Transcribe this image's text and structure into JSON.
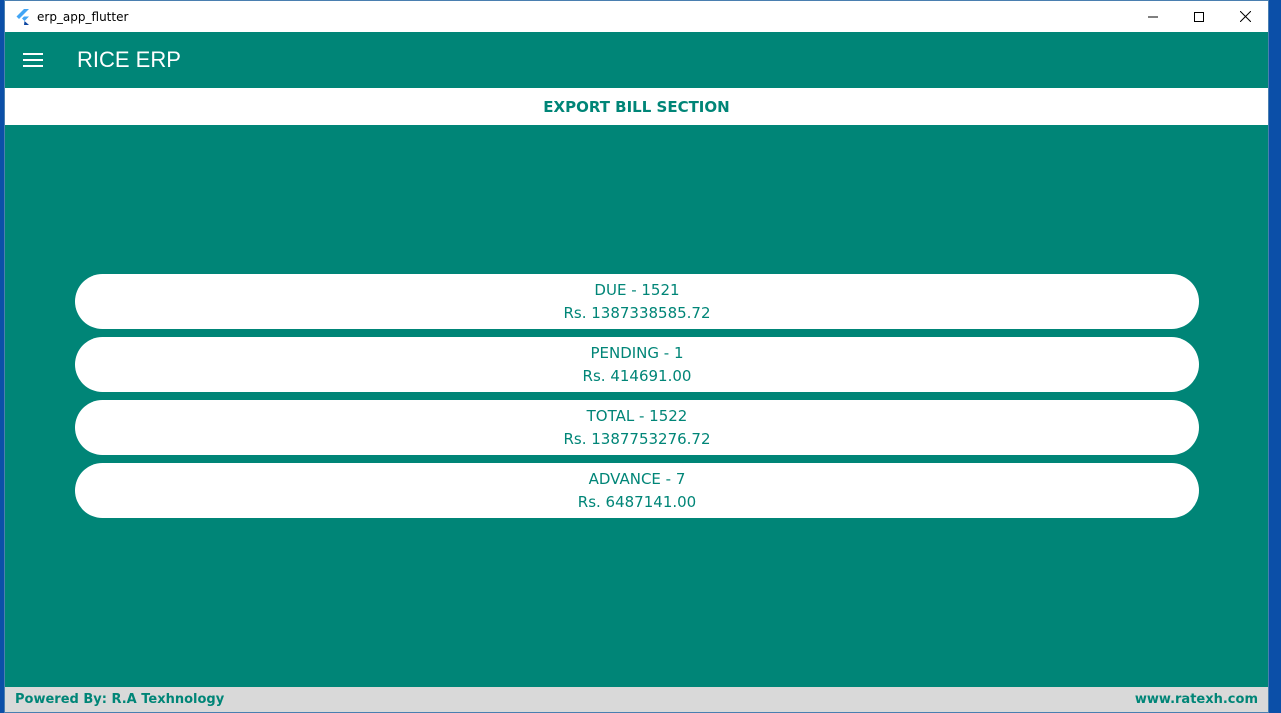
{
  "window": {
    "title": "erp_app_flutter",
    "controls": {
      "minimize_icon": "minimize-icon",
      "maximize_icon": "maximize-icon",
      "close_icon": "close-icon"
    }
  },
  "appbar": {
    "title": "RICE ERP",
    "menu_icon": "menu-icon"
  },
  "section": {
    "title": "EXPORT BILL SECTION"
  },
  "cards": [
    {
      "label": "DUE - 1521",
      "amount": "Rs. 1387338585.72"
    },
    {
      "label": "PENDING - 1",
      "amount": "Rs. 414691.00"
    },
    {
      "label": "TOTAL - 1522",
      "amount": "Rs. 1387753276.72"
    },
    {
      "label": "ADVANCE - 7",
      "amount": "Rs. 6487141.00"
    }
  ],
  "footer": {
    "powered_by": "Powered By: R.A Texhnology",
    "website": "www.ratexh.com"
  },
  "colors": {
    "primary": "#008577",
    "surface": "#ffffff",
    "footer_bg": "#d9d9d9"
  }
}
